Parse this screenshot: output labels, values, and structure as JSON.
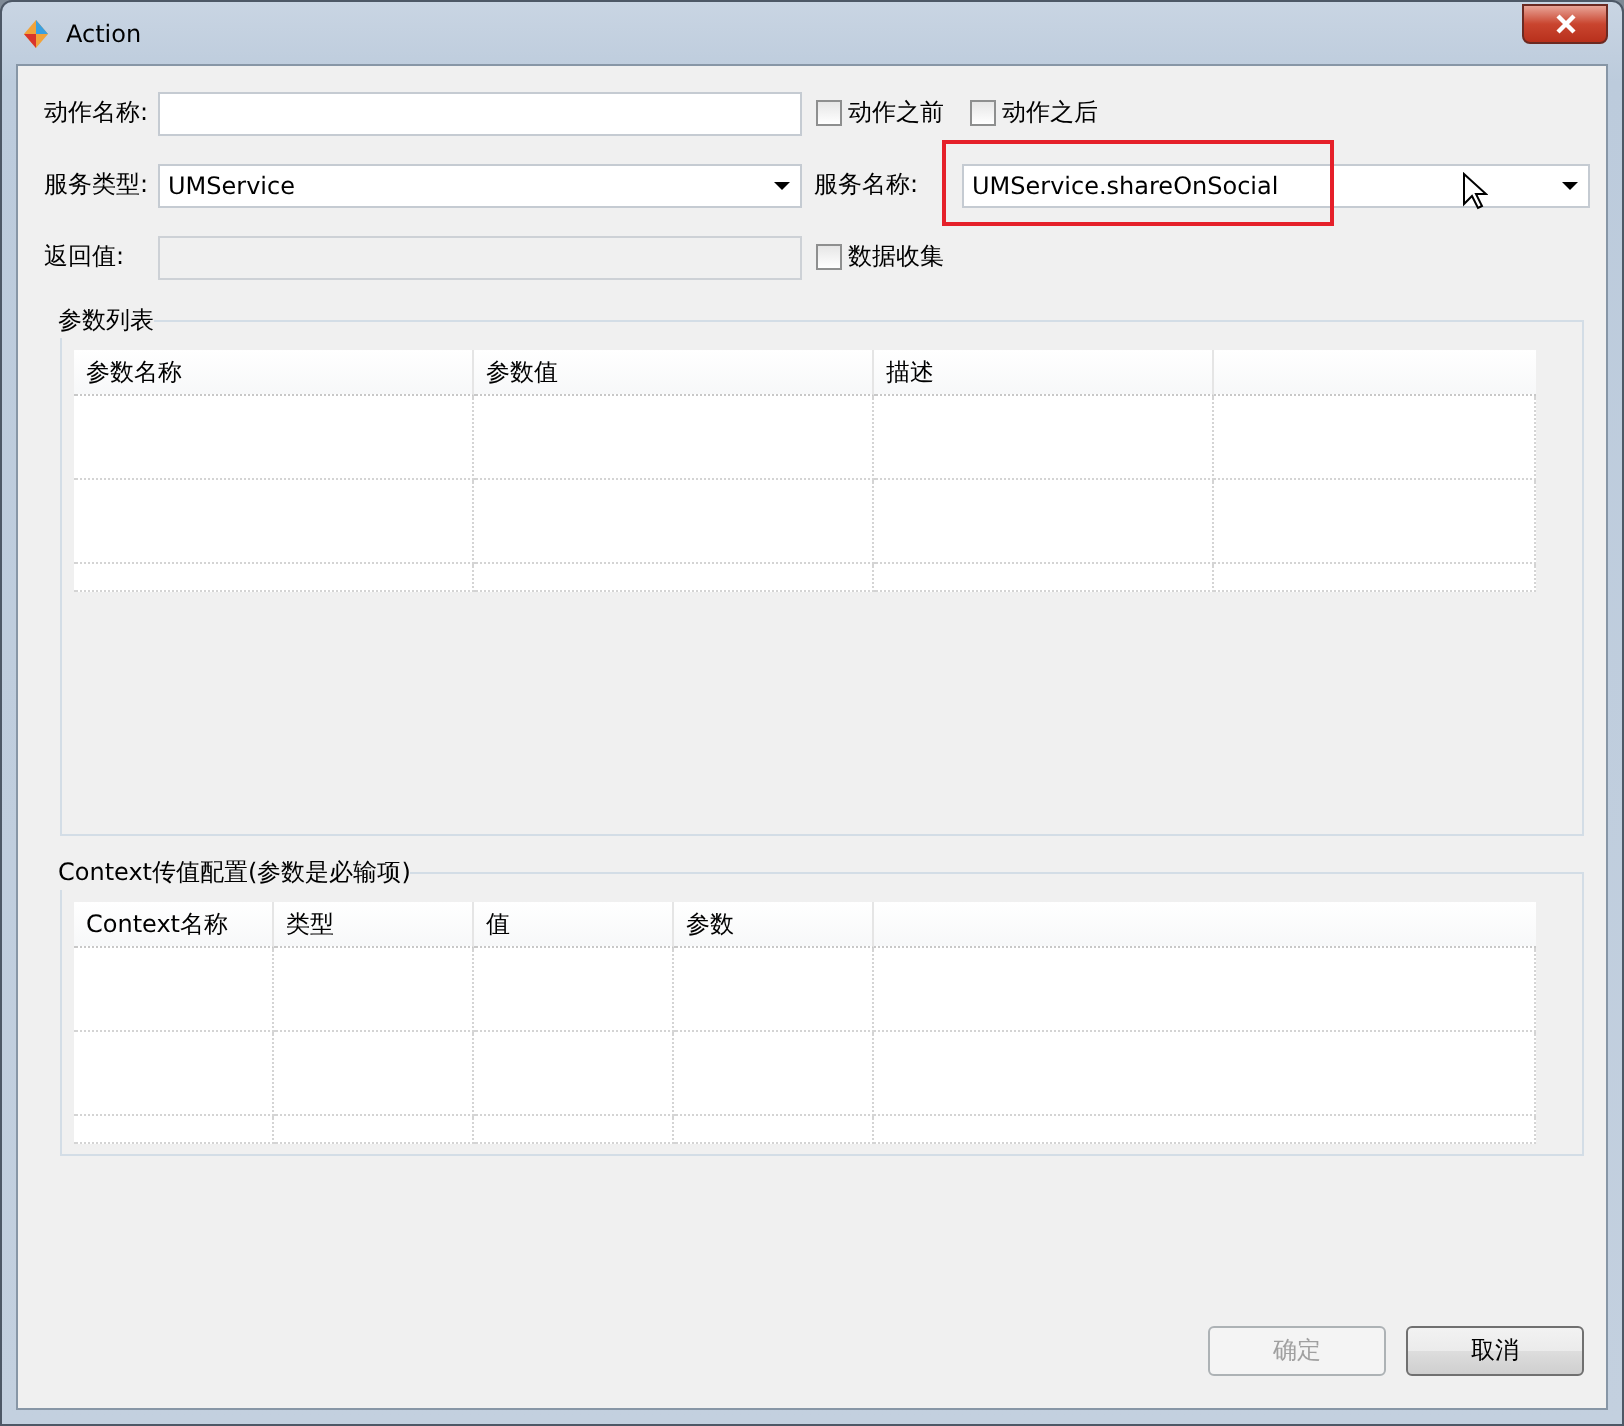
{
  "window": {
    "title": "Action"
  },
  "form_rows": [
    [
      {
        "kind": "label",
        "text": "动作名称:"
      },
      {
        "kind": "input",
        "disabled": false
      },
      {
        "kind": "checkbox",
        "label": "动作之前",
        "checked": false
      },
      {
        "kind": "checkbox",
        "label": "动作之后",
        "checked": false
      }
    ],
    [
      {
        "kind": "label",
        "text": "服务类型:"
      },
      {
        "kind": "select",
        "value": "UMService",
        "highlighted": false
      },
      {
        "kind": "label",
        "text": "服务名称:"
      },
      {
        "kind": "select",
        "value": "UMService.shareOnSocial",
        "highlighted": true
      }
    ],
    [
      {
        "kind": "label",
        "text": "返回值:"
      },
      {
        "kind": "input",
        "disabled": true
      },
      {
        "kind": "checkbox",
        "label": "数据收集",
        "checked": false
      }
    ]
  ],
  "groups": [
    {
      "title": "参数列表",
      "columns": [
        "参数名称",
        "参数值",
        "描述"
      ]
    },
    {
      "title": "Context传值配置(参数是必输项)",
      "columns": [
        "Context名称",
        "类型",
        "值",
        "参数"
      ]
    }
  ],
  "buttons": [
    {
      "label": "确定",
      "disabled": true
    },
    {
      "label": "取消",
      "disabled": false
    }
  ]
}
